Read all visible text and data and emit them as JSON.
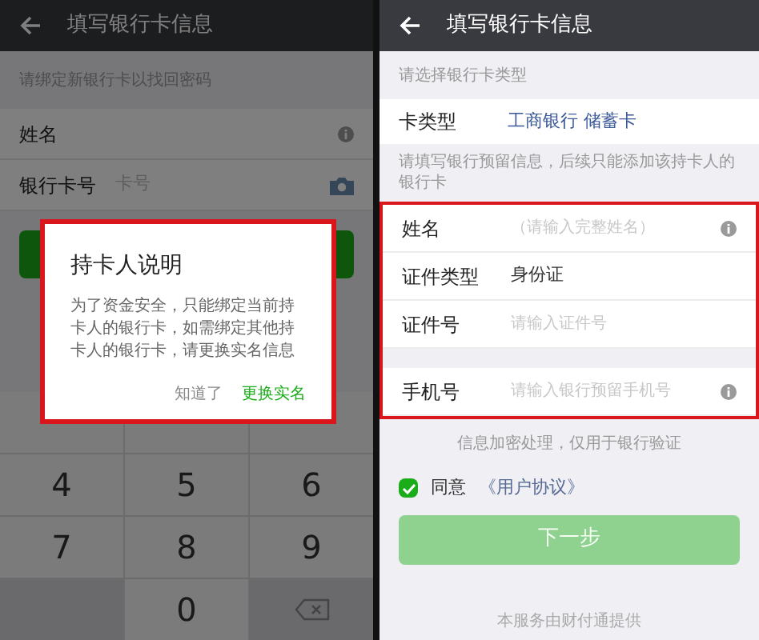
{
  "left_screen": {
    "title": "填写银行卡信息",
    "hint": "请绑定新银行卡以找回密码",
    "fields": [
      {
        "label": "姓名",
        "kind": "info"
      },
      {
        "label": "银行卡号",
        "placeholder": "卡号",
        "kind": "camera"
      }
    ],
    "keys": [
      {
        "kind": "covered"
      },
      {
        "kind": "covered"
      },
      {
        "kind": "covered"
      },
      {
        "kind": "digit",
        "label": "4"
      },
      {
        "kind": "digit",
        "label": "5"
      },
      {
        "kind": "digit",
        "label": "6"
      },
      {
        "kind": "digit",
        "label": "7"
      },
      {
        "kind": "digit",
        "label": "8"
      },
      {
        "kind": "digit",
        "label": "9"
      },
      {
        "kind": "blank"
      },
      {
        "kind": "digit",
        "label": "0"
      },
      {
        "kind": "backspace"
      }
    ],
    "dialog": {
      "title": "持卡人说明",
      "message": "为了资金安全，只能绑定当前持卡人的银行卡，如需绑定其他持卡人的银行卡，请更换实名信息",
      "highlighted": true,
      "buttons": [
        {
          "label": "知道了",
          "kind": "secondary"
        },
        {
          "label": "更换实名",
          "kind": "primary"
        }
      ]
    }
  },
  "right_screen": {
    "title": "填写银行卡信息",
    "card_type_hint": "请选择银行卡类型",
    "card_type": {
      "label": "卡类型",
      "value": "工商银行 储蓄卡"
    },
    "info_hint": "请填写银行预留信息，后续只能添加该持卡人的银行卡",
    "fields_highlighted": true,
    "field_groups": [
      [
        {
          "label": "姓名",
          "placeholder": "（请输入完整姓名）",
          "kind": "info"
        },
        {
          "label": "证件类型",
          "value": "身份证",
          "kind": "plain"
        },
        {
          "label": "证件号",
          "placeholder": "请输入证件号",
          "kind": "plain"
        }
      ],
      [
        {
          "label": "手机号",
          "placeholder": "请输入银行预留手机号",
          "kind": "info"
        }
      ]
    ],
    "privacy_note": "信息加密处理，仅用于银行验证",
    "agreement": {
      "checked": true,
      "label": "同意",
      "link": "《用户协议》"
    },
    "next_button": {
      "label": "下一步",
      "disabled": true
    },
    "footer": "本服务由财付通提供"
  }
}
